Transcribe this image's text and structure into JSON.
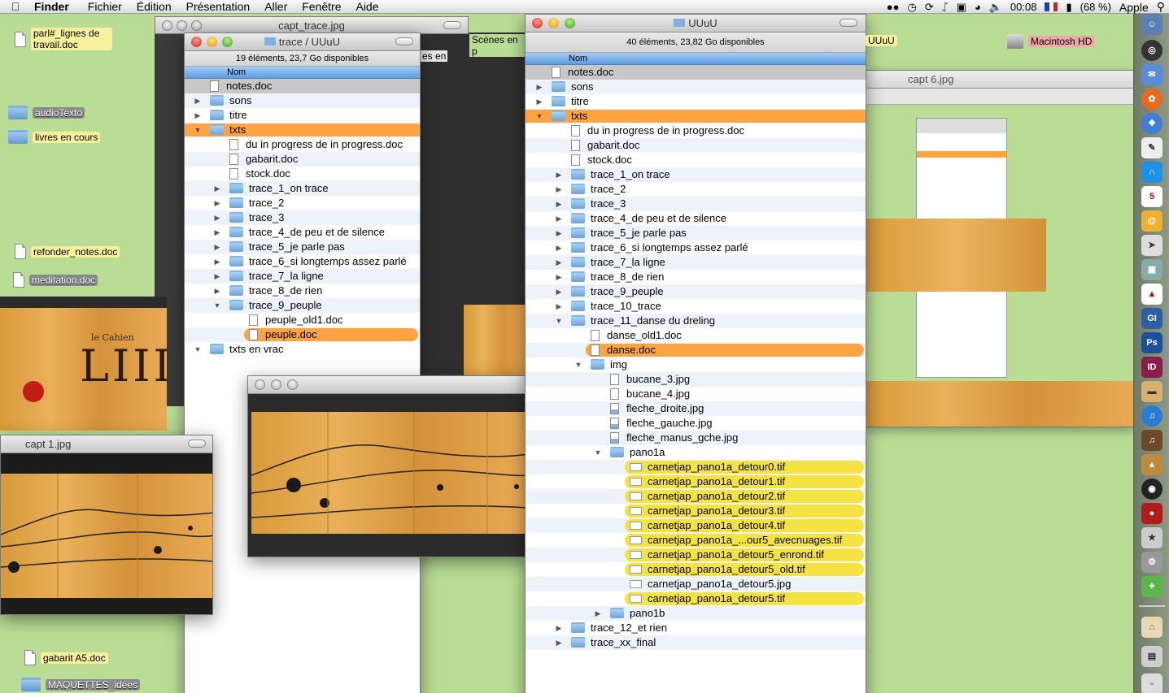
{
  "menubar": {
    "app": "Finder",
    "items": [
      "Fichier",
      "Édition",
      "Présentation",
      "Aller",
      "Fenêtre",
      "Aide"
    ],
    "clock": "00:08",
    "battery": "(68 %)",
    "user": "Apple"
  },
  "desktop": {
    "icons": [
      {
        "label": "parl#_lignes de travail.doc",
        "kind": "doc"
      },
      {
        "label": "audioTexto",
        "kind": "folder"
      },
      {
        "label": "livres en cours",
        "kind": "folder"
      },
      {
        "label": "refonder_notes.doc",
        "kind": "doc"
      },
      {
        "label": "meditation.doc",
        "kind": "doc"
      },
      {
        "label": "gabarit A5.doc",
        "kind": "doc"
      },
      {
        "label": "MAQUETTES_idées",
        "kind": "folder"
      },
      {
        "label": "Macintosh HD",
        "kind": "disk"
      },
      {
        "label": "UUuU",
        "kind": "label"
      },
      {
        "label": "Scènes en p",
        "kind": "label"
      },
      {
        "label": "es en",
        "kind": "label"
      }
    ]
  },
  "windows": {
    "capt_trace": {
      "title": "capt_trace.jpg"
    },
    "capt1": {
      "title": "capt 1.jpg"
    },
    "capt6": {
      "title": "capt 6.jpg"
    },
    "left_finder": {
      "title": "trace / UUuU",
      "status": "19 éléments, 23,7 Go disponibles",
      "column": "Nom",
      "rows": [
        {
          "name": "notes.doc"
        },
        {
          "name": "sons"
        },
        {
          "name": "titre"
        },
        {
          "name": "txts"
        },
        {
          "name": "du in progress de in progress.doc"
        },
        {
          "name": "gabarit.doc"
        },
        {
          "name": "stock.doc"
        },
        {
          "name": "trace_1_on trace"
        },
        {
          "name": "trace_2"
        },
        {
          "name": "trace_3"
        },
        {
          "name": "trace_4_de peu et de silence"
        },
        {
          "name": "trace_5_je parle pas"
        },
        {
          "name": "trace_6_si longtemps assez parlé"
        },
        {
          "name": "trace_7_la ligne"
        },
        {
          "name": "trace_8_de rien"
        },
        {
          "name": "trace_9_peuple"
        },
        {
          "name": "peuple_old1.doc"
        },
        {
          "name": "peuple.doc"
        },
        {
          "name": "txts en vrac"
        }
      ]
    },
    "main_finder": {
      "title": "UUuU",
      "status": "40 éléments, 23,82 Go disponibles",
      "column": "Nom",
      "rows": [
        {
          "name": "notes.doc"
        },
        {
          "name": "sons"
        },
        {
          "name": "titre"
        },
        {
          "name": "txts"
        },
        {
          "name": "du in progress de in progress.doc"
        },
        {
          "name": "gabarit.doc"
        },
        {
          "name": "stock.doc"
        },
        {
          "name": "trace_1_on trace"
        },
        {
          "name": "trace_2"
        },
        {
          "name": "trace_3"
        },
        {
          "name": "trace_4_de peu et de silence"
        },
        {
          "name": "trace_5_je parle pas"
        },
        {
          "name": "trace_6_si longtemps assez parlé"
        },
        {
          "name": "trace_7_la ligne"
        },
        {
          "name": "trace_8_de rien"
        },
        {
          "name": "trace_9_peuple"
        },
        {
          "name": "trace_10_trace"
        },
        {
          "name": "trace_11_danse du dreling"
        },
        {
          "name": "danse_old1.doc"
        },
        {
          "name": "danse.doc"
        },
        {
          "name": "img"
        },
        {
          "name": "bucane_3.jpg"
        },
        {
          "name": "bucane_4.jpg"
        },
        {
          "name": "fleche_droite.jpg"
        },
        {
          "name": "fleche_gauche.jpg"
        },
        {
          "name": "fleche_manus_gche.jpg"
        },
        {
          "name": "pano1a"
        },
        {
          "name": "carnetjap_pano1a_detour0.tif"
        },
        {
          "name": "carnetjap_pano1a_detour1.tif"
        },
        {
          "name": "carnetjap_pano1a_detour2.tif"
        },
        {
          "name": "carnetjap_pano1a_detour3.tif"
        },
        {
          "name": "carnetjap_pano1a_detour4.tif"
        },
        {
          "name": "carnetjap_pano1a_...our5_avecnuages.tif"
        },
        {
          "name": "carnetjap_pano1a_detour5_enrond.tif"
        },
        {
          "name": "carnetjap_pano1a_detour5_old.tif"
        },
        {
          "name": "carnetjap_pano1a_detour5.jpg"
        },
        {
          "name": "carnetjap_pano1a_detour5.tif"
        },
        {
          "name": "pano1b"
        },
        {
          "name": "trace_12_et rien"
        },
        {
          "name": "trace_xx_final"
        }
      ]
    }
  },
  "photo_text": [
    "le Cahien",
    "LIII"
  ],
  "dock": {
    "calendar_day": "5",
    "items": [
      "GI",
      "Ps",
      "ID"
    ]
  },
  "colors": {
    "desktop": "#b9dd95",
    "label_orange": "#ffa442",
    "label_yellow": "#f5e341",
    "selection_blue": "#5d9ce0"
  }
}
